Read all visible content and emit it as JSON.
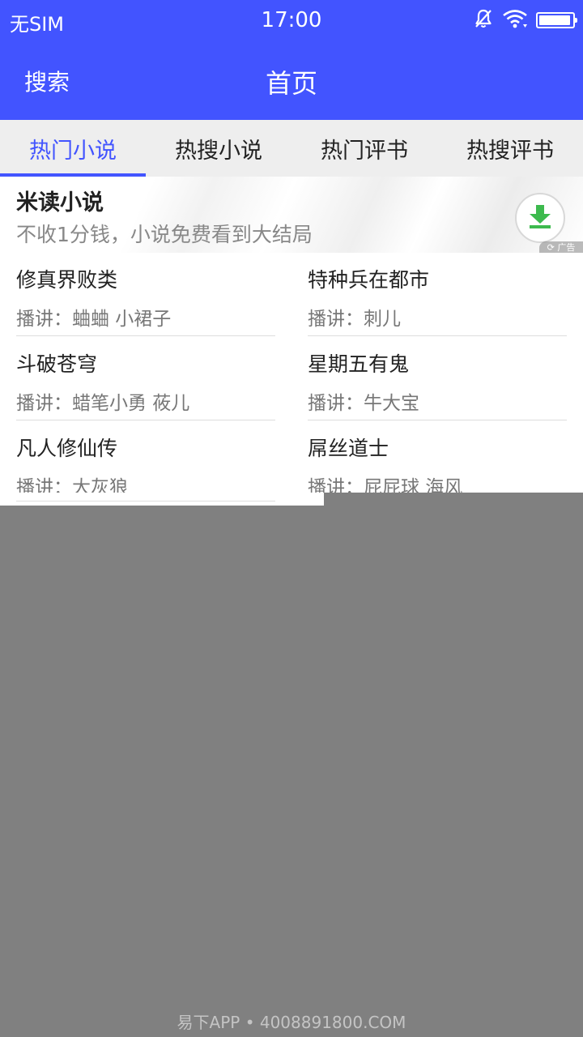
{
  "status_bar": {
    "carrier": "无SIM",
    "time": "17:00",
    "battery_level": 0.95
  },
  "header": {
    "search_label": "搜索",
    "title": "首页"
  },
  "tabs": [
    {
      "label": "热门小说",
      "active": true
    },
    {
      "label": "热搜小说",
      "active": false
    },
    {
      "label": "热门评书",
      "active": false
    },
    {
      "label": "热搜评书",
      "active": false
    }
  ],
  "ad": {
    "title": "米读小说",
    "description": "不收1分钱，小说免费看到大结局",
    "badge": "广告"
  },
  "list": {
    "items": [
      {
        "name": "修真界败类",
        "narrator": "播讲：蛐蛐 小裙子"
      },
      {
        "name": "特种兵在都市",
        "narrator": "播讲：刺儿"
      },
      {
        "name": "斗破苍穹",
        "narrator": "播讲：蜡笔小勇 莜儿"
      },
      {
        "name": "星期五有鬼",
        "narrator": "播讲：牛大宝"
      },
      {
        "name": "凡人修仙传",
        "narrator": "播讲：大灰狼"
      },
      {
        "name": "屌丝道士",
        "narrator": "播讲：屁屁球 海风"
      }
    ]
  },
  "footer": {
    "text": "易下APP • 4008891800.COM"
  },
  "colors": {
    "accent": "#4254FF",
    "download_green": "#3DBA4E",
    "overlay_gray": "#808080"
  }
}
